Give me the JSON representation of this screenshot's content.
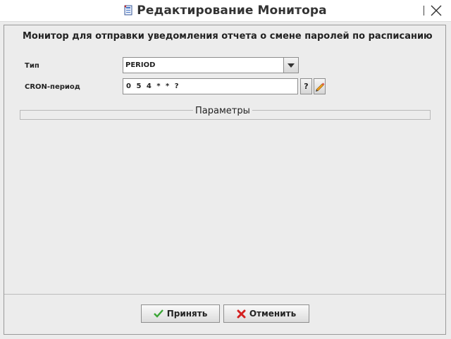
{
  "window": {
    "title": "Редактирование Монитора"
  },
  "monitor": {
    "title": "Монитор для отправки уведомления отчета о смене паролей по расписанию"
  },
  "form": {
    "type_label": "Тип",
    "type_value": "PERIOD",
    "cron_label": "CRON-период",
    "cron_value": "0 5 4 * * ?",
    "help_label": "?"
  },
  "params": {
    "legend": "Параметры"
  },
  "footer": {
    "accept_label": "Принять",
    "cancel_label": "Отменить"
  },
  "colors": {
    "accept_icon": "#3aa635",
    "cancel_icon": "#d42020"
  },
  "icons": {
    "app": "app-icon",
    "close": "close-icon",
    "dropdown": "chevron-down-icon",
    "edit": "pencil-icon",
    "accept": "check-icon",
    "cancel": "cross-icon"
  }
}
